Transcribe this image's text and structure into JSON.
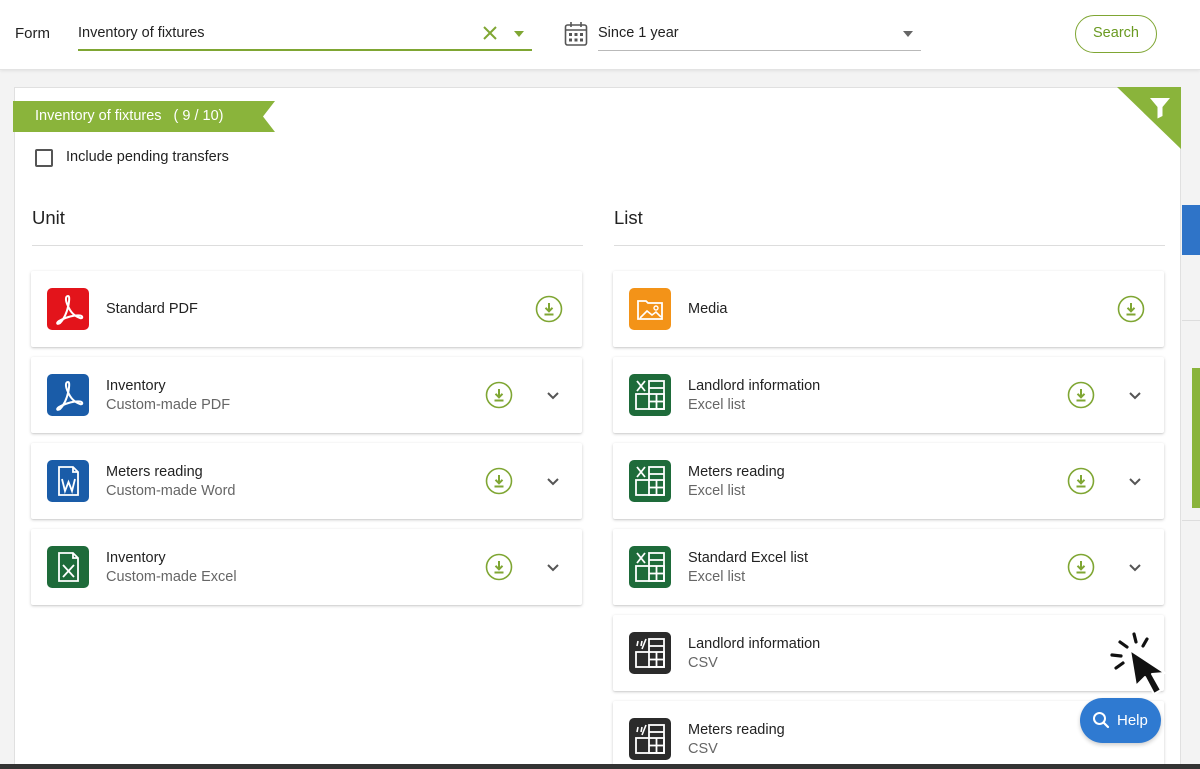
{
  "topbar": {
    "form_label": "Form",
    "form_value": "Inventory of fixtures",
    "period_value": "Since 1 year",
    "search_label": "Search"
  },
  "panel": {
    "ribbon_title": "Inventory of fixtures",
    "ribbon_count": "( 9 / 10)",
    "pending_label": "Include pending transfers",
    "unit_title": "Unit",
    "list_title": "List"
  },
  "unit_cards": [
    {
      "title": "Standard PDF",
      "subtitle": "",
      "icon": "pdf-icon",
      "color": "#e3141b",
      "expandable": false
    },
    {
      "title": "Inventory",
      "subtitle": "Custom-made PDF",
      "icon": "pdf-icon",
      "color": "#1a5ca8",
      "expandable": true
    },
    {
      "title": "Meters reading",
      "subtitle": "Custom-made Word",
      "icon": "word-icon",
      "color": "#1a5ca8",
      "expandable": true
    },
    {
      "title": "Inventory",
      "subtitle": "Custom-made Excel",
      "icon": "excel-icon",
      "color": "#1e6b3a",
      "expandable": true
    }
  ],
  "list_cards": [
    {
      "title": "Media",
      "subtitle": "",
      "icon": "media-icon",
      "color": "#f39318",
      "expandable": false
    },
    {
      "title": "Landlord information",
      "subtitle": "Excel list",
      "icon": "excel-table-icon",
      "color": "#1e6b3a",
      "expandable": true
    },
    {
      "title": "Meters reading",
      "subtitle": "Excel list",
      "icon": "excel-table-icon",
      "color": "#1e6b3a",
      "expandable": true
    },
    {
      "title": "Standard Excel list",
      "subtitle": "Excel list",
      "icon": "excel-table-icon",
      "color": "#1e6b3a",
      "expandable": true
    },
    {
      "title": "Landlord information",
      "subtitle": "CSV",
      "icon": "csv-icon",
      "color": "#2b2b2b",
      "expandable": false
    },
    {
      "title": "Meters reading",
      "subtitle": "CSV",
      "icon": "csv-icon",
      "color": "#2b2b2b",
      "expandable": false
    }
  ],
  "help_label": "Help",
  "colors": {
    "accent": "#7fa633",
    "help": "#2f7ad1"
  }
}
